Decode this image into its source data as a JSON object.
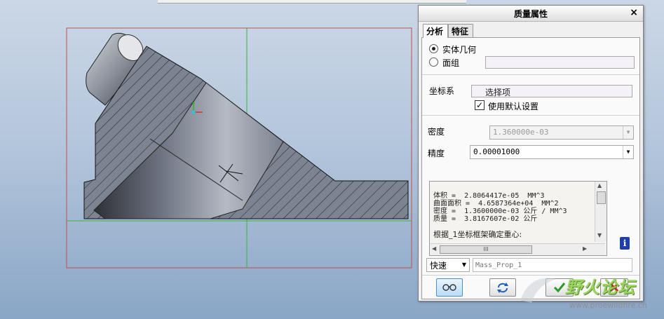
{
  "dialog": {
    "title": "质量属性",
    "close_glyph": "×",
    "tabs": [
      {
        "label": "分析",
        "active": true
      },
      {
        "label": "特征",
        "active": false
      }
    ],
    "geometry": {
      "solid_label": "实体几何",
      "solid_selected": true,
      "quilt_label": "面组",
      "quilt_selected": false
    },
    "csys": {
      "label": "坐标系",
      "select_text": "选择项",
      "use_default_label": "使用默认设置",
      "use_default_checked": true
    },
    "density": {
      "label": "密度",
      "value": "1.360000e-03",
      "enabled": false
    },
    "precision": {
      "label": "精度",
      "value": "0.00001000"
    },
    "results": {
      "lines": [
        "体积 =  2.8064417e-05  MM^3",
        "曲面面积 =  4.6587364e+04  MM^2",
        "密度 =  1.3600000e-03 公斤 / MM^3",
        "质量 =  3.8167607e-02 公斤",
        "",
        "根据_1坐标框架确定重心:"
      ],
      "hscroll_grip": "III"
    },
    "mode": {
      "value": "快速"
    },
    "feature_name_placeholder": "Mass_Prop_1",
    "icons": {
      "info": "info-icon",
      "view": "glasses-icon",
      "repeat": "repeat-icon",
      "ok": "check-icon",
      "cancel": "cross-icon"
    },
    "colors": {
      "ok": "#2a9a2a",
      "cancel": "#d02020",
      "info": "#1e3fa8",
      "view_button": "#b9dcf6"
    }
  },
  "watermark": {
    "text": "野火论坛",
    "url": "www.proewildfire.cn"
  },
  "viewport": {
    "colors": {
      "part_metal": "#7a8290",
      "frame": "#c0504d",
      "axis_green": "#3cb33c"
    }
  }
}
